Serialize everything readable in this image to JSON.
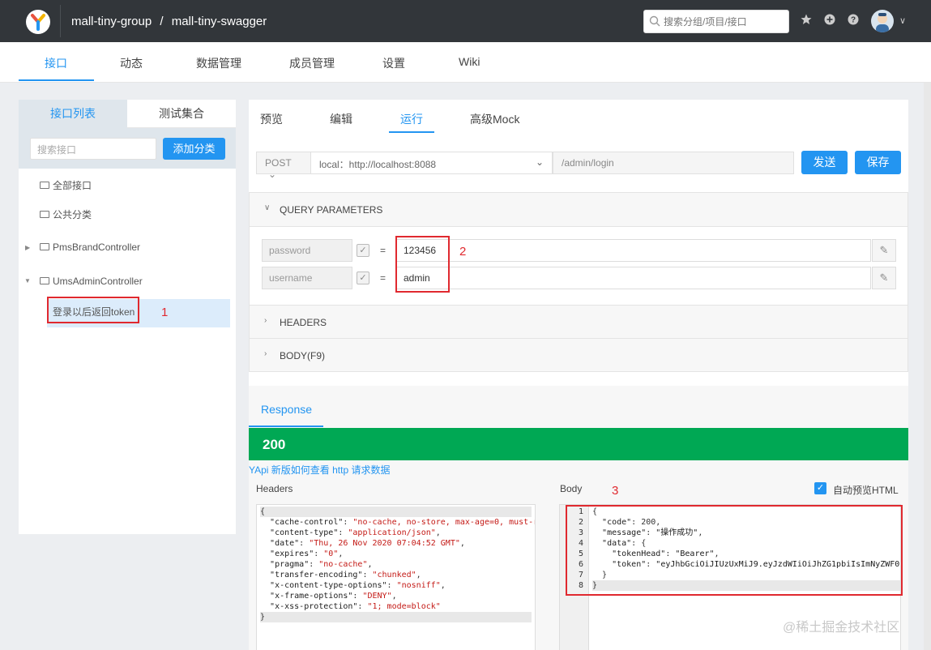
{
  "header": {
    "group": "mall-tiny-group",
    "separator": "/",
    "project": "mall-tiny-swagger",
    "search_placeholder": "搜索分组/项目/接口"
  },
  "nav": {
    "tabs": [
      "接口",
      "动态",
      "数据管理",
      "成员管理",
      "设置",
      "Wiki"
    ],
    "active_index": 0
  },
  "sidebar": {
    "tab_list": "接口列表",
    "tab_collection": "测试集合",
    "search_placeholder": "搜索接口",
    "add_category": "添加分类",
    "items": [
      "全部接口",
      "公共分类",
      "PmsBrandController",
      "UmsAdminController"
    ],
    "active_leaf": "登录以后返回token"
  },
  "editor": {
    "tabs": [
      "预览",
      "编辑",
      "运行",
      "高级Mock"
    ],
    "active_tab": "运行",
    "method": "POST",
    "env": "local：http://localhost:8088",
    "path": "/admin/login",
    "send_label": "发送",
    "save_label": "保存"
  },
  "query": {
    "title": "QUERY PARAMETERS",
    "params": [
      {
        "name": "password",
        "value": "123456"
      },
      {
        "name": "username",
        "value": "admin"
      }
    ],
    "equals": "="
  },
  "headers_section": "HEADERS",
  "body_section": "BODY(F9)",
  "response": {
    "tab": "Response",
    "status": "200",
    "hint": "YApi 新版如何查看 http 请求数据",
    "headers_label": "Headers",
    "body_label": "Body",
    "preview_html": "自动预览HTML"
  },
  "annotations": {
    "n1": "1",
    "n2": "2",
    "n3": "3"
  },
  "watermark": "@稀土掘金技术社区",
  "colors": {
    "accent": "#2395f1",
    "success": "#00a854",
    "highlight": "#e0292f"
  }
}
